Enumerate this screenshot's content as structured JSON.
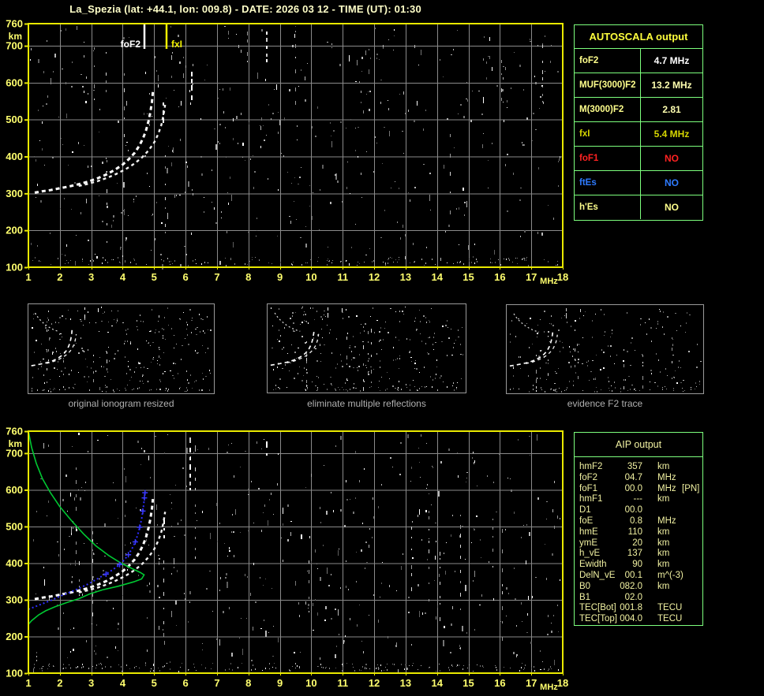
{
  "title": "La_Spezia (lat: +44.1, lon: 009.8) - DATE: 2026 03 12 - TIME (UT): 01:30",
  "colors": {
    "frame_yellow": "#e9e900",
    "tick_yellow": "#ffff6e",
    "grid_gray": "#8a8a8a",
    "table_border_green": "#7dff7d",
    "profile_green": "#00c832",
    "restored_blue": "#2d2dff",
    "trace_white": "#ffffff",
    "marker_foF2": "#ffffff",
    "marker_fxI": "#f0f000"
  },
  "autoscala": {
    "title": "AUTOSCALA output",
    "rows": [
      {
        "label": "foF2",
        "value": "4.7 MHz",
        "label_color": "#ffff8c",
        "value_color": "#ffffff"
      },
      {
        "label": "MUF(3000)F2",
        "value": "13.2 MHz",
        "label_color": "#ffff8c",
        "value_color": "#ffffb0"
      },
      {
        "label": "M(3000)F2",
        "value": "2.81",
        "label_color": "#ffff8c",
        "value_color": "#ffffb0"
      },
      {
        "label": "fxI",
        "value": "5.4 MHz",
        "label_color": "#d6d600",
        "value_color": "#d6d600"
      },
      {
        "label": "foF1",
        "value": "NO",
        "label_color": "#ff2222",
        "value_color": "#ff2222"
      },
      {
        "label": "ftEs",
        "value": "NO",
        "label_color": "#2e7bff",
        "value_color": "#2e7bff"
      },
      {
        "label": "h'Es",
        "value": "NO",
        "label_color": "#ffff8c",
        "value_color": "#ffff8c"
      }
    ]
  },
  "thumbnails": [
    {
      "caption": "original ionogram resized"
    },
    {
      "caption": "eliminate multiple reflections"
    },
    {
      "caption": "evidence F2 trace"
    }
  ],
  "aip": {
    "title": "AIP output",
    "rows": [
      {
        "label": "hmF2",
        "value": "357",
        "unit": "km",
        "note": ""
      },
      {
        "label": "foF2",
        "value": "04.7",
        "unit": "MHz",
        "note": ""
      },
      {
        "label": "foF1",
        "value": "00.0",
        "unit": "MHz",
        "note": "[PN]"
      },
      {
        "label": "hmF1",
        "value": "---",
        "unit": "km",
        "note": ""
      },
      {
        "label": "D1",
        "value": "00.0",
        "unit": "",
        "note": ""
      },
      {
        "label": "foE",
        "value": "0.8",
        "unit": "MHz",
        "note": ""
      },
      {
        "label": "hmE",
        "value": "110",
        "unit": "km",
        "note": ""
      },
      {
        "label": "ymE",
        "value": "20",
        "unit": "km",
        "note": ""
      },
      {
        "label": "h_vE",
        "value": "137",
        "unit": "km",
        "note": ""
      },
      {
        "label": "Ewidth",
        "value": "90",
        "unit": "km",
        "note": ""
      },
      {
        "label": "DelN_vE",
        "value": "00.1",
        "unit": "m^(-3)",
        "note": ""
      },
      {
        "label": "B0",
        "value": "082.0",
        "unit": "km",
        "note": ""
      },
      {
        "label": "B1",
        "value": "02.0",
        "unit": "",
        "note": ""
      },
      {
        "label": "TEC[Bot]",
        "value": "001.8",
        "unit": "TECU",
        "note": ""
      },
      {
        "label": "TEC[Top]",
        "value": "004.0",
        "unit": "TECU",
        "note": ""
      }
    ]
  },
  "chart_data": [
    {
      "type": "scatter",
      "id": "main_ionogram",
      "xlabel": "MHz",
      "ylabel": "km",
      "xlim": [
        1,
        18
      ],
      "ylim": [
        100,
        760
      ],
      "grid": true,
      "x_ticks": [
        1,
        2,
        3,
        4,
        5,
        6,
        7,
        8,
        9,
        10,
        11,
        12,
        13,
        14,
        15,
        16,
        17,
        18
      ],
      "y_ticks": [
        760,
        700,
        600,
        500,
        400,
        300,
        200,
        100
      ],
      "markers": [
        {
          "name": "foF2",
          "freq_mhz": 4.7,
          "color": "#ffffff",
          "side": "left"
        },
        {
          "name": "fxI",
          "freq_mhz": 5.4,
          "color": "#f0f000",
          "side": "right"
        }
      ],
      "series": [
        {
          "name": "F2 trace X-mode",
          "role": "trace_x",
          "points": [
            [
              2.6,
              320
            ],
            [
              2.9,
              326
            ],
            [
              3.2,
              333
            ],
            [
              3.5,
              342
            ],
            [
              3.8,
              353
            ],
            [
              4.1,
              366
            ],
            [
              4.38,
              381
            ],
            [
              4.62,
              398
            ],
            [
              4.83,
              417
            ],
            [
              5.0,
              438
            ],
            [
              5.13,
              461
            ],
            [
              5.23,
              486
            ],
            [
              5.3,
              512
            ],
            [
              5.35,
              540
            ]
          ]
        },
        {
          "name": "F2 trace O-mode",
          "role": "trace_o",
          "points": [
            [
              1.2,
              302
            ],
            [
              1.45,
              306
            ],
            [
              1.7,
              309
            ],
            [
              2.0,
              314
            ],
            [
              2.3,
              319
            ],
            [
              2.6,
              325
            ],
            [
              2.9,
              332
            ],
            [
              3.2,
              341
            ],
            [
              3.5,
              352
            ],
            [
              3.75,
              364
            ],
            [
              4.0,
              378
            ],
            [
              4.2,
              393
            ],
            [
              4.38,
              410
            ],
            [
              4.52,
              428
            ],
            [
              4.64,
              448
            ],
            [
              4.74,
              470
            ],
            [
              4.82,
              495
            ],
            [
              4.88,
              520
            ],
            [
              4.93,
              548
            ],
            [
              4.96,
              575
            ]
          ]
        }
      ],
      "streaks": [
        [
          5.28,
          546,
          482
        ],
        [
          6.17,
          630,
          548
        ],
        [
          8.55,
          738,
          655
        ]
      ]
    },
    {
      "type": "scatter",
      "id": "ionogram_with_inverted_profile",
      "xlabel": "MHz",
      "ylabel": "km",
      "xlim": [
        1,
        18
      ],
      "ylim": [
        100,
        760
      ],
      "grid": true,
      "x_ticks": [
        1,
        2,
        3,
        4,
        5,
        6,
        7,
        8,
        9,
        10,
        11,
        12,
        13,
        14,
        15,
        16,
        17,
        18
      ],
      "y_ticks": [
        760,
        700,
        600,
        500,
        400,
        300,
        200,
        100
      ],
      "markers": [],
      "series": [
        {
          "name": "F2 trace X-mode",
          "role": "trace_x",
          "points": [
            [
              2.6,
              320
            ],
            [
              2.9,
              326
            ],
            [
              3.2,
              333
            ],
            [
              3.5,
              342
            ],
            [
              3.8,
              353
            ],
            [
              4.1,
              366
            ],
            [
              4.38,
              381
            ],
            [
              4.62,
              398
            ],
            [
              4.83,
              417
            ],
            [
              5.0,
              438
            ],
            [
              5.13,
              461
            ],
            [
              5.23,
              486
            ],
            [
              5.3,
              512
            ],
            [
              5.35,
              540
            ]
          ]
        },
        {
          "name": "F2 trace O-mode",
          "role": "trace_o",
          "points": [
            [
              1.2,
              302
            ],
            [
              1.45,
              306
            ],
            [
              1.7,
              309
            ],
            [
              2.0,
              314
            ],
            [
              2.3,
              319
            ],
            [
              2.6,
              325
            ],
            [
              2.9,
              332
            ],
            [
              3.2,
              341
            ],
            [
              3.5,
              352
            ],
            [
              3.75,
              364
            ],
            [
              4.0,
              378
            ],
            [
              4.2,
              393
            ],
            [
              4.38,
              410
            ],
            [
              4.52,
              428
            ],
            [
              4.64,
              448
            ],
            [
              4.74,
              470
            ],
            [
              4.82,
              495
            ],
            [
              4.88,
              520
            ],
            [
              4.93,
              548
            ],
            [
              4.96,
              575
            ]
          ]
        },
        {
          "name": "Electron density profile",
          "role": "profile",
          "points": [
            [
              1.0,
              760
            ],
            [
              1.1,
              716
            ],
            [
              1.25,
              672
            ],
            [
              1.45,
              630
            ],
            [
              1.7,
              592
            ],
            [
              2.0,
              554
            ],
            [
              2.35,
              518
            ],
            [
              2.75,
              480
            ],
            [
              3.15,
              447
            ],
            [
              3.55,
              421
            ],
            [
              3.95,
              400
            ],
            [
              4.3,
              385
            ],
            [
              4.55,
              375
            ],
            [
              4.68,
              368
            ],
            [
              4.6,
              357
            ],
            [
              4.35,
              349
            ],
            [
              3.85,
              337
            ],
            [
              3.35,
              327
            ],
            [
              2.95,
              316
            ],
            [
              2.6,
              303
            ],
            [
              2.2,
              292
            ],
            [
              1.85,
              281
            ],
            [
              1.55,
              270
            ],
            [
              1.33,
              259
            ],
            [
              1.1,
              243
            ],
            [
              1.0,
              233
            ]
          ]
        },
        {
          "name": "Restored O-trace",
          "role": "restored",
          "points": [
            [
              1.0,
              274
            ],
            [
              1.35,
              286
            ],
            [
              1.7,
              298
            ],
            [
              2.1,
              313
            ],
            [
              2.5,
              327
            ],
            [
              2.85,
              341
            ],
            [
              3.15,
              355
            ],
            [
              3.45,
              370
            ],
            [
              3.7,
              383
            ],
            [
              3.9,
              396
            ],
            [
              4.05,
              409
            ],
            [
              4.18,
              423
            ],
            [
              4.3,
              440
            ],
            [
              4.4,
              458
            ],
            [
              4.48,
              478
            ],
            [
              4.54,
              498
            ],
            [
              4.6,
              520
            ],
            [
              4.64,
              542
            ],
            [
              4.67,
              562
            ],
            [
              4.69,
              578
            ],
            [
              4.71,
              592
            ]
          ],
          "cross_points": [
            [
              3.47,
              370
            ],
            [
              3.9,
              396
            ],
            [
              4.18,
              423
            ],
            [
              4.4,
              458
            ],
            [
              4.54,
              498
            ],
            [
              4.64,
              542
            ],
            [
              4.69,
              578
            ],
            [
              4.71,
              592
            ]
          ]
        }
      ],
      "streaks": [
        [
          6.13,
          742,
          585
        ],
        [
          8.57,
          731,
          694
        ],
        [
          5.3,
          520,
          468
        ]
      ]
    }
  ],
  "thumbnail_extra_trace": {
    "name": "second hop arc",
    "role": "multiple",
    "points": [
      [
        1.55,
        700
      ],
      [
        1.8,
        668
      ],
      [
        2.1,
        640
      ],
      [
        2.45,
        614
      ],
      [
        2.85,
        592
      ],
      [
        3.3,
        572
      ],
      [
        3.75,
        560
      ]
    ]
  },
  "thumbnail_streaks": [
    [
      6.1,
      745,
      655
    ],
    [
      7.35,
      735,
      700
    ]
  ]
}
